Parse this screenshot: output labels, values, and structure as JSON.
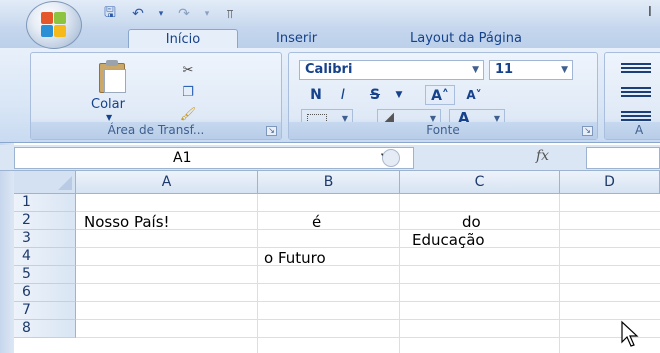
{
  "title_bar": {
    "title_fragment": "I",
    "qat_icons": [
      "save-icon",
      "undo-icon",
      "undo-dropdown-icon",
      "redo-icon",
      "redo-dropdown-icon",
      "customize-qat-icon"
    ]
  },
  "tabs": [
    {
      "label": "Início",
      "active": true
    },
    {
      "label": "Inserir",
      "active": false
    },
    {
      "label": "Layout da Página",
      "active": false
    }
  ],
  "ribbon": {
    "clipboard": {
      "paste_label": "Colar",
      "group_label": "Área de Transf..."
    },
    "font": {
      "group_label": "Fonte",
      "font_name": "Calibri",
      "font_size": "11",
      "bold": "N",
      "italic": "I",
      "strike": "S",
      "grow": "A˄",
      "shrink": "A˅",
      "font_color_letter": "A"
    },
    "alignment": {
      "group_label": "A"
    },
    "colors": {
      "fill": "#f5e31c",
      "font_color": "#e11c1c"
    }
  },
  "formula_bar": {
    "name_box": "A1",
    "fx_label": "fx",
    "value": ""
  },
  "grid": {
    "columns": [
      "A",
      "B",
      "C",
      "D"
    ],
    "rows": [
      "1",
      "2",
      "3",
      "4",
      "5",
      "6",
      "7",
      "8"
    ],
    "cells": {
      "A2": "Nosso País!",
      "B2": "é",
      "C2": "do",
      "C3": "Educação",
      "B4": "o Futuro"
    }
  }
}
